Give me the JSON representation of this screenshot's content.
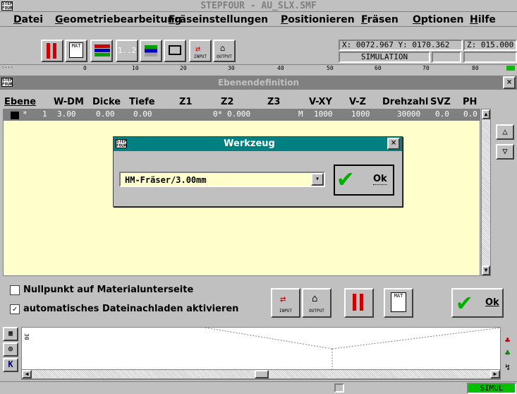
{
  "app": {
    "title": "STEPFOUR - AU_SLX.SMF",
    "logo_text": "STEP FOUR"
  },
  "menu": [
    "Datei",
    "Geometriebearbeitung",
    "Fräseinstellungen",
    "Positionieren",
    "Fräsen",
    "Optionen",
    "Hilfe"
  ],
  "toolbar": {
    "mat_label": "MAT",
    "layer_label": "1..2",
    "input_label": "INPUT",
    "output_label": "OUTPUT"
  },
  "coords": {
    "x": "X: 0072.967",
    "y": "Y: 0170.362",
    "z": "Z: 015.000",
    "mode": "SIMULATION"
  },
  "ruler": [
    "0",
    "10",
    "20",
    "30",
    "40",
    "50",
    "60",
    "70",
    "80"
  ],
  "ebenen": {
    "title": "Ebenendefinition",
    "close": "×",
    "columns": [
      "Ebene",
      "W-DM",
      "Dicke",
      "Tiefe",
      "Z1",
      "Z2",
      "Z3",
      "V-XY",
      "V-Z",
      "Drehzahl",
      "SVZ",
      "PH"
    ],
    "row": [
      "*",
      "1",
      "3.00",
      "0.00",
      "0.00",
      "0*",
      "0.000",
      "M",
      "1000",
      "1000",
      "30000",
      "0.0",
      "0.0"
    ],
    "check_nullpunkt": "Nullpunkt auf Materialunterseite",
    "check_nullpunkt_checked": false,
    "check_auto": "automatisches Dateinachladen aktivieren",
    "check_auto_checked": true,
    "ok_label": "Ok",
    "input_label": "INPUT",
    "output_label": "OUTPUT",
    "mat_label": "MAT"
  },
  "werkzeug": {
    "title": "Werkzeug",
    "close": "×",
    "tool_value": "HM-Fräser/3.00mm",
    "ok_label": "Ok"
  },
  "lower": {
    "ruler_text": "30",
    "k_label": "K"
  },
  "status": {
    "mode": "SIMUL"
  },
  "colors": {
    "title_active": "#008080",
    "title_inactive": "#808080",
    "panel_bg": "#ffffcc",
    "status_green": "#00c000"
  }
}
